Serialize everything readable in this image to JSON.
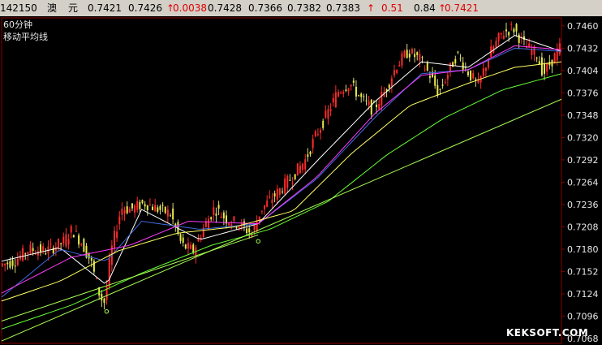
{
  "quote": {
    "code": "142150",
    "name1": "澳",
    "name2": "元",
    "price": "0.7421",
    "open": "0.7426",
    "change": "0.0038",
    "high": "0.7428",
    "low": "0.7366",
    "bid": "0.7382",
    "ask": "0.7383",
    "chg_pct": "0.51",
    "ratio": "0.84",
    "last": "0.7421",
    "arrow": "↑"
  },
  "chart_header": {
    "period": "60分钟",
    "indicator": "移动平均线"
  },
  "watermark": "KEKSOFT.COM",
  "chart_data": {
    "type": "candlestick",
    "ylim": [
      0.7062,
      0.747
    ],
    "yticks": [
      "0.7460",
      "0.7432",
      "0.7404",
      "0.7376",
      "0.7348",
      "0.7320",
      "0.7292",
      "0.7264",
      "0.7236",
      "0.7208",
      "0.7180",
      "0.7152",
      "0.7124",
      "0.7096",
      "0.7068"
    ],
    "bar_count": 220,
    "close_path": [
      [
        0,
        0.716
      ],
      [
        12,
        0.7165
      ],
      [
        25,
        0.718
      ],
      [
        40,
        0.7178
      ],
      [
        55,
        0.719
      ],
      [
        62,
        0.7205
      ],
      [
        70,
        0.7188
      ],
      [
        78,
        0.7165
      ],
      [
        86,
        0.712
      ],
      [
        90,
        0.7113
      ],
      [
        95,
        0.7175
      ],
      [
        104,
        0.7232
      ],
      [
        112,
        0.723
      ],
      [
        124,
        0.7238
      ],
      [
        136,
        0.723
      ],
      [
        146,
        0.7225
      ],
      [
        156,
        0.7185
      ],
      [
        166,
        0.7178
      ],
      [
        174,
        0.7205
      ],
      [
        184,
        0.7232
      ],
      [
        194,
        0.7218
      ],
      [
        204,
        0.7212
      ],
      [
        216,
        0.72
      ],
      [
        224,
        0.723
      ],
      [
        236,
        0.7248
      ],
      [
        250,
        0.727
      ],
      [
        262,
        0.7292
      ],
      [
        270,
        0.732
      ],
      [
        280,
        0.7348
      ],
      [
        290,
        0.7378
      ],
      [
        300,
        0.7388
      ],
      [
        310,
        0.7368
      ],
      [
        320,
        0.7355
      ],
      [
        330,
        0.7378
      ],
      [
        340,
        0.741
      ],
      [
        350,
        0.7428
      ],
      [
        360,
        0.7418
      ],
      [
        370,
        0.7395
      ],
      [
        376,
        0.7375
      ],
      [
        384,
        0.74
      ],
      [
        392,
        0.7425
      ],
      [
        400,
        0.7405
      ],
      [
        410,
        0.7385
      ],
      [
        420,
        0.7425
      ],
      [
        430,
        0.745
      ],
      [
        440,
        0.7458
      ],
      [
        450,
        0.7435
      ],
      [
        460,
        0.7425
      ],
      [
        466,
        0.74
      ],
      [
        474,
        0.7418
      ],
      [
        480,
        0.7432
      ]
    ],
    "moving_averages": [
      {
        "color": "#ffffff",
        "path": [
          [
            0,
            0.7165
          ],
          [
            50,
            0.7182
          ],
          [
            90,
            0.7135
          ],
          [
            120,
            0.723
          ],
          [
            170,
            0.7192
          ],
          [
            220,
            0.7212
          ],
          [
            270,
            0.729
          ],
          [
            320,
            0.7365
          ],
          [
            360,
            0.7415
          ],
          [
            400,
            0.7408
          ],
          [
            440,
            0.7448
          ],
          [
            480,
            0.7428
          ]
        ]
      },
      {
        "color": "#4169e1",
        "path": [
          [
            0,
            0.712
          ],
          [
            50,
            0.718
          ],
          [
            90,
            0.7165
          ],
          [
            120,
            0.7215
          ],
          [
            170,
            0.7205
          ],
          [
            220,
            0.7212
          ],
          [
            270,
            0.7268
          ],
          [
            320,
            0.7345
          ],
          [
            360,
            0.74
          ],
          [
            400,
            0.7405
          ],
          [
            440,
            0.7432
          ],
          [
            480,
            0.7428
          ]
        ]
      },
      {
        "color": "#ff3cff",
        "path": [
          [
            0,
            0.7125
          ],
          [
            60,
            0.717
          ],
          [
            110,
            0.7185
          ],
          [
            160,
            0.7215
          ],
          [
            220,
            0.7212
          ],
          [
            270,
            0.727
          ],
          [
            320,
            0.735
          ],
          [
            360,
            0.7398
          ],
          [
            400,
            0.7405
          ],
          [
            440,
            0.7435
          ],
          [
            480,
            0.743
          ]
        ]
      },
      {
        "color": "#ffff66",
        "path": [
          [
            0,
            0.7115
          ],
          [
            50,
            0.714
          ],
          [
            100,
            0.7178
          ],
          [
            150,
            0.72
          ],
          [
            200,
            0.7208
          ],
          [
            250,
            0.7228
          ],
          [
            300,
            0.73
          ],
          [
            350,
            0.736
          ],
          [
            400,
            0.7388
          ],
          [
            440,
            0.7408
          ],
          [
            480,
            0.7415
          ]
        ]
      },
      {
        "color": "#66ff33",
        "path": [
          [
            0,
            0.708
          ],
          [
            60,
            0.711
          ],
          [
            120,
            0.715
          ],
          [
            180,
            0.7185
          ],
          [
            230,
            0.7205
          ],
          [
            280,
            0.724
          ],
          [
            330,
            0.7298
          ],
          [
            380,
            0.7345
          ],
          [
            430,
            0.738
          ],
          [
            480,
            0.74
          ]
        ]
      }
    ],
    "trend_lines": [
      {
        "color": "#aaff55",
        "from": [
          0,
          0.7065
        ],
        "to": [
          480,
          0.7368
        ]
      },
      {
        "color": "#aaff55",
        "from": [
          0,
          0.709
        ],
        "to": [
          220,
          0.7198
        ]
      }
    ],
    "pivot_points": [
      [
        90,
        0.7102
      ],
      [
        220,
        0.719
      ]
    ]
  }
}
